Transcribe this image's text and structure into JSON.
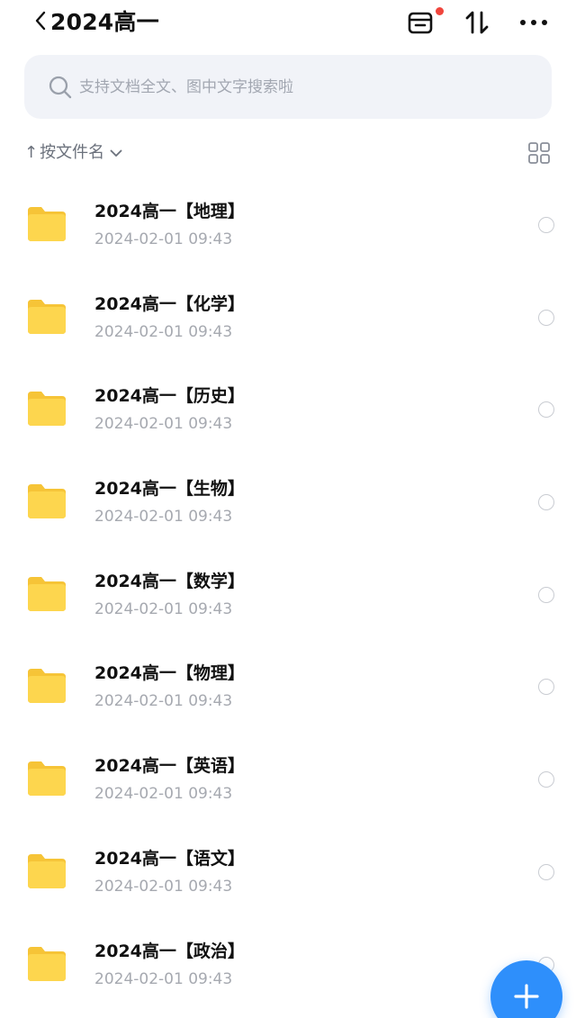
{
  "header": {
    "title": "2024高一",
    "notification_color": "#f0453c"
  },
  "search": {
    "placeholder": "支持文档全文、图中文字搜索啦"
  },
  "sort": {
    "arrow": "↑",
    "label": "按文件名"
  },
  "files": [
    {
      "name": "2024高一【地理】",
      "date": "2024-02-01 09:43",
      "icon": "folder-icon"
    },
    {
      "name": "2024高一【化学】",
      "date": "2024-02-01 09:43",
      "icon": "folder-icon"
    },
    {
      "name": "2024高一【历史】",
      "date": "2024-02-01 09:43",
      "icon": "folder-icon"
    },
    {
      "name": "2024高一【生物】",
      "date": "2024-02-01 09:43",
      "icon": "folder-icon"
    },
    {
      "name": "2024高一【数学】",
      "date": "2024-02-01 09:43",
      "icon": "folder-icon"
    },
    {
      "name": "2024高一【物理】",
      "date": "2024-02-01 09:43",
      "icon": "folder-icon"
    },
    {
      "name": "2024高一【英语】",
      "date": "2024-02-01 09:43",
      "icon": "folder-icon"
    },
    {
      "name": "2024高一【语文】",
      "date": "2024-02-01 09:43",
      "icon": "folder-icon"
    },
    {
      "name": "2024高一【政治】",
      "date": "2024-02-01 09:43",
      "icon": "folder-icon"
    }
  ],
  "colors": {
    "folder": "#fcd34a",
    "fab": "#2e8ffb",
    "accent_gray": "#a6a9b0"
  }
}
